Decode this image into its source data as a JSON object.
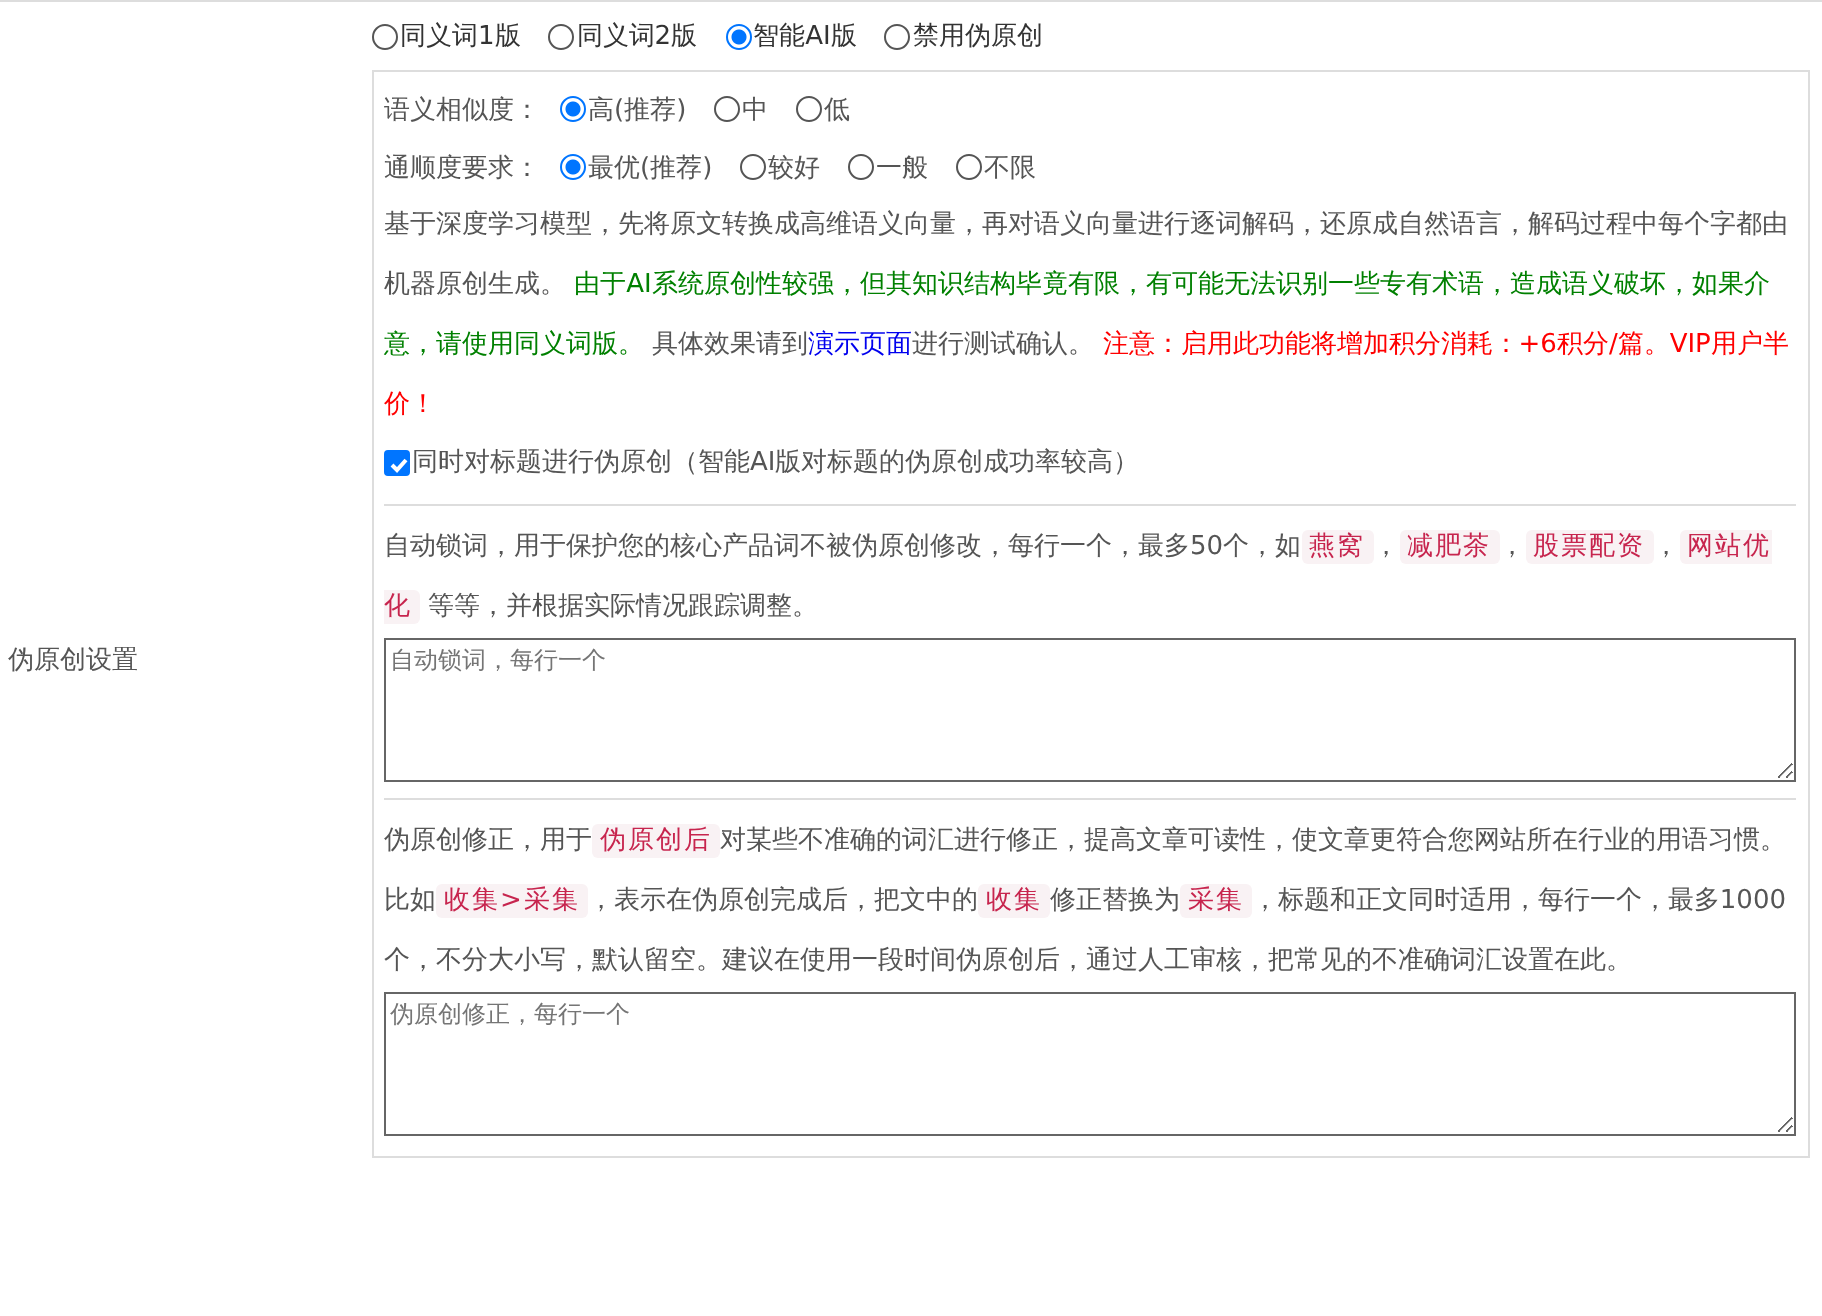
{
  "mode_options": [
    {
      "label": "同义词1版",
      "selected": false
    },
    {
      "label": "同义词2版",
      "selected": false
    },
    {
      "label": "智能AI版",
      "selected": true
    },
    {
      "label": "禁用伪原创",
      "selected": false
    }
  ],
  "side_label": "伪原创设置",
  "ai_settings": {
    "groups": [
      {
        "label": "语义相似度：",
        "options": [
          {
            "label": "高(推荐)",
            "selected": true
          },
          {
            "label": "中",
            "selected": false
          },
          {
            "label": "低",
            "selected": false
          }
        ]
      },
      {
        "label": "通顺度要求：",
        "options": [
          {
            "label": "最优(推荐)",
            "selected": true
          },
          {
            "label": "较好",
            "selected": false
          },
          {
            "label": "一般",
            "selected": false
          },
          {
            "label": "不限",
            "selected": false
          }
        ]
      }
    ],
    "description": [
      {
        "kind": "plain",
        "text": "基于深度学习模型，先将原文转换成高维语义向量，再对语义向量进行逐词解码，还原成自然语言，解码过程中每个字都由机器原创生成。 "
      },
      {
        "kind": "green",
        "text": "由于AI系统原创性较强，但其知识结构毕竟有限，有可能无法识别一些专有术语，造成语义破坏，如果介意，请使用同义词版。"
      },
      {
        "kind": "plain",
        "text": " 具体效果请到"
      },
      {
        "kind": "link",
        "text": "演示页面"
      },
      {
        "kind": "plain",
        "text": "进行测试确认。 "
      },
      {
        "kind": "warning",
        "text": "注意：启用此功能将增加积分消耗：+6积分/篇。VIP用户半价！"
      }
    ],
    "title_option": {
      "label": "同时对标题进行伪原创（智能AI版对标题的伪原创成功率较高）",
      "checked": true
    }
  },
  "lock_words": {
    "description": [
      {
        "kind": "plain",
        "text": "自动锁词，用于保护您的核心产品词不被伪原创修改，每行一个，最多50个，如"
      },
      {
        "kind": "code",
        "text": "燕窝"
      },
      {
        "kind": "plain",
        "text": "，"
      },
      {
        "kind": "code",
        "text": "减肥茶"
      },
      {
        "kind": "plain",
        "text": "，"
      },
      {
        "kind": "code",
        "text": "股票配资"
      },
      {
        "kind": "plain",
        "text": "，"
      },
      {
        "kind": "code",
        "text": "网站优化"
      },
      {
        "kind": "plain",
        "text": " 等等，并根据实际情况跟踪调整。"
      }
    ],
    "placeholder": "自动锁词，每行一个"
  },
  "corrections": {
    "description": [
      {
        "kind": "plain",
        "text": "伪原创修正，用于"
      },
      {
        "kind": "code",
        "text": "伪原创后"
      },
      {
        "kind": "plain",
        "text": "对某些不准确的词汇进行修正，提高文章可读性，使文章更符合您网站所在行业的用语习惯。比如"
      },
      {
        "kind": "code",
        "text": "收集>采集"
      },
      {
        "kind": "plain",
        "text": "，表示在伪原创完成后，把文中的"
      },
      {
        "kind": "code",
        "text": "收集"
      },
      {
        "kind": "plain",
        "text": "修正替换为"
      },
      {
        "kind": "code",
        "text": "采集"
      },
      {
        "kind": "plain",
        "text": "，标题和正文同时适用，每行一个，最多1000个，不分大小写，默认留空。建议在使用一段时间伪原创后，通过人工审核，把常见的不准确词汇设置在此。"
      }
    ],
    "placeholder": "伪原创修正，每行一个"
  }
}
